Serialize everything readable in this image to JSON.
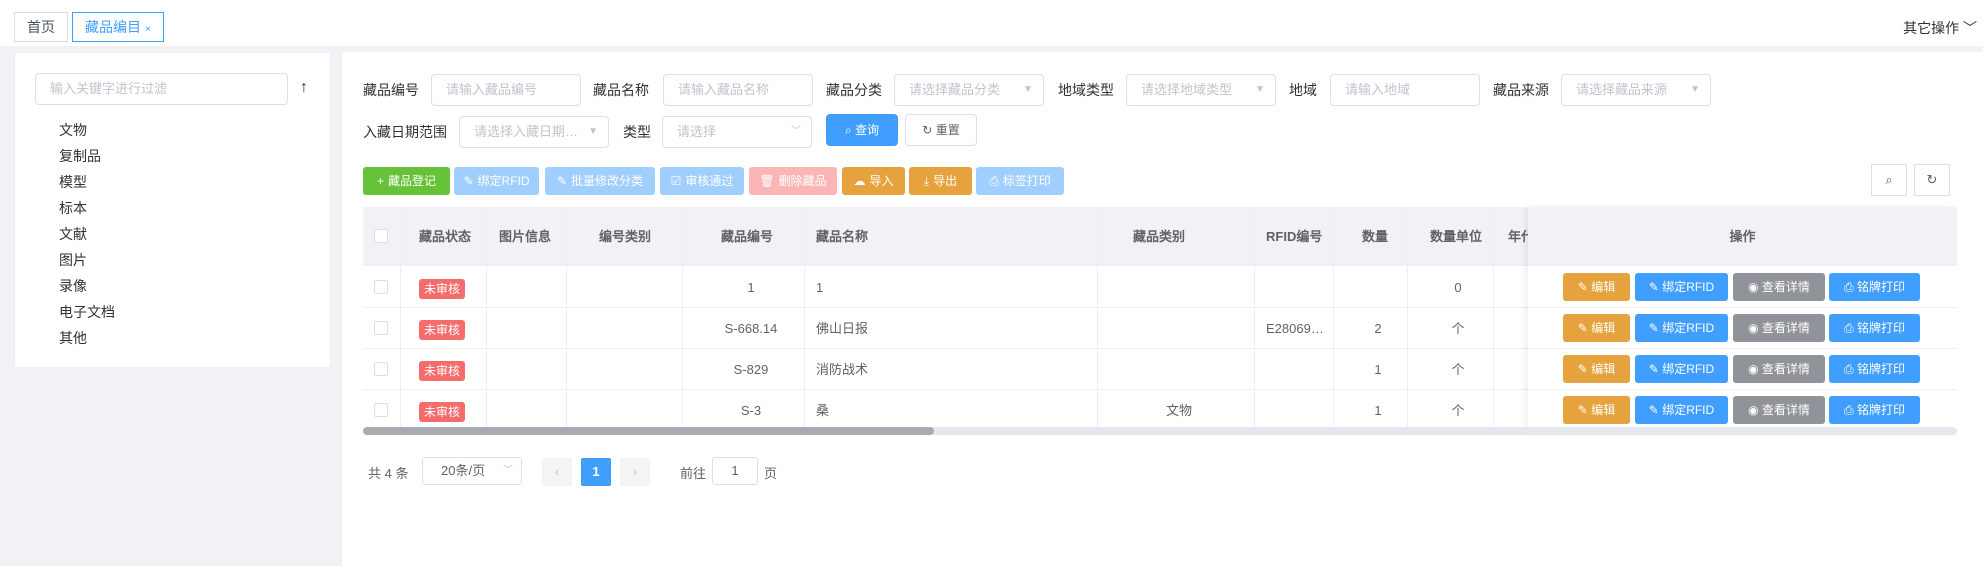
{
  "tabs": [
    {
      "label": "首页"
    },
    {
      "label": "藏品编目",
      "close": "×"
    }
  ],
  "other_ops": "其它操作 ﹀",
  "tree": {
    "filter_placeholder": "输入关键字进行过滤",
    "up_icon": "↑",
    "items": [
      "文物",
      "复制品",
      "模型",
      "标本",
      "文献",
      "图片",
      "录像",
      "电子文档",
      "其他"
    ]
  },
  "form": {
    "code_label": "藏品编号",
    "code_placeholder": "请输入藏品编号",
    "name_label": "藏品名称",
    "name_placeholder": "请输入藏品名称",
    "category_label": "藏品分类",
    "category_placeholder": "请选择藏品分类",
    "region_type_label": "地域类型",
    "region_type_placeholder": "请选择地域类型",
    "region_label": "地域",
    "region_placeholder": "请输入地域",
    "source_label": "藏品来源",
    "source_placeholder": "请选择藏品来源",
    "date_label": "入藏日期范围",
    "date_placeholder": "请选择入藏日期…",
    "type_label": "类型",
    "type_placeholder": "请选择",
    "query_btn": "查询",
    "reset_btn": "重置"
  },
  "toolbar": {
    "register": "藏品登记",
    "bind_rfid": "绑定RFID",
    "batch_edit": "批量修改分类",
    "audit": "审核通过",
    "delete": "删除藏品",
    "import": "导入",
    "export": "导出",
    "label_print": "标签打印"
  },
  "table": {
    "headers": {
      "status": "藏品状态",
      "image": "图片信息",
      "code_type": "编号类别",
      "code": "藏品编号",
      "name": "藏品名称",
      "category": "藏品类别",
      "rfid": "RFID编号",
      "qty": "数量",
      "unit": "数量单位",
      "year": "年代",
      "ops": "操作"
    },
    "rows": [
      {
        "status": "未审核",
        "image": "",
        "code_type": "",
        "code": "1",
        "name": "1",
        "category": "",
        "rfid": "",
        "qty": "",
        "unit": "0"
      },
      {
        "status": "未审核",
        "image": "",
        "code_type": "",
        "code": "S-668.14",
        "name": "佛山日报",
        "category": "",
        "rfid": "E28069…",
        "qty": "2",
        "unit": "个"
      },
      {
        "status": "未审核",
        "image": "",
        "code_type": "",
        "code": "S-829",
        "name": "消防战术",
        "category": "",
        "rfid": "",
        "qty": "1",
        "unit": "个"
      },
      {
        "status": "未审核",
        "image": "",
        "code_type": "",
        "code": "S-3",
        "name": "桑",
        "category": "文物",
        "rfid": "",
        "qty": "1",
        "unit": "个"
      }
    ],
    "row_ops": {
      "edit": "编辑",
      "bind": "绑定RFID",
      "detail": "查看详情",
      "plate": "铭牌打印"
    }
  },
  "pagination": {
    "total": "共 4 条",
    "page_size": "20条/页",
    "current": "1",
    "prev": "‹",
    "next": "›",
    "goto_prefix": "前往",
    "goto_value": "1",
    "goto_suffix": "页"
  },
  "colors": {
    "primary": "#409eff",
    "success": "#67c23a",
    "warning": "#e6a23c",
    "danger": "#f56c6c",
    "info": "#909399"
  }
}
